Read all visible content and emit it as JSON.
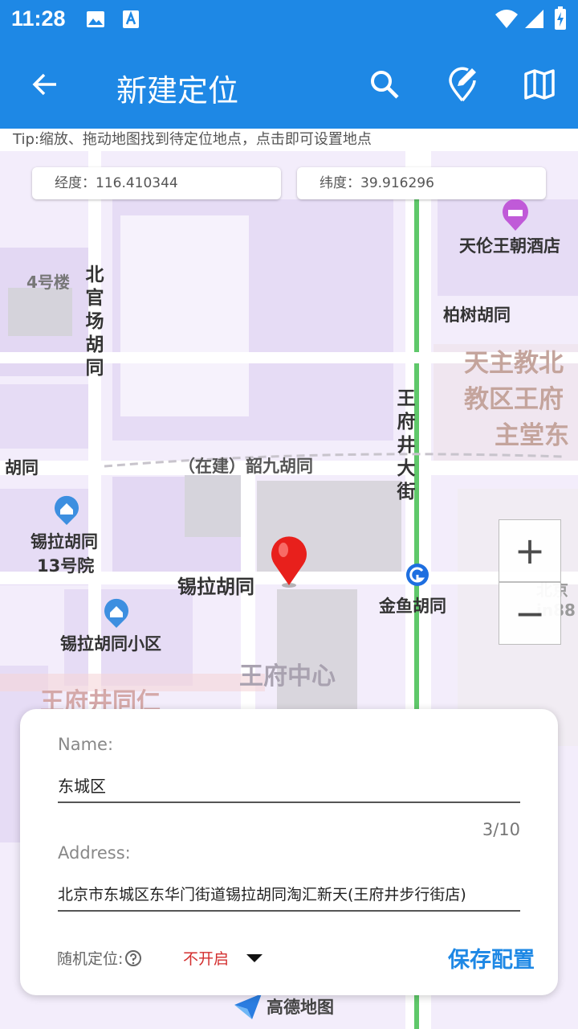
{
  "status_bar": {
    "time": "11:28"
  },
  "app_bar": {
    "title": "新建定位"
  },
  "tip": "Tip:缩放、拖动地图找到待定位地点，点击即可设置地点",
  "coords": {
    "longitude": "经度：116.410344",
    "latitude": "纬度：39.916296"
  },
  "map_labels": {
    "hotel": "天伦王朝酒店",
    "building4": "4号楼",
    "beiguanchang": "北官场胡同",
    "baishu": "柏树胡同",
    "church": [
      "天主教北",
      "教区王府",
      "主堂东"
    ],
    "wangfujing_st": "王府井大街",
    "shaojiu": "（在建）韶九胡同",
    "hutong_left": "胡同",
    "xila13": [
      "锡拉胡同",
      "13号院"
    ],
    "xila": "锡拉胡同",
    "jinyu": "金鱼胡同",
    "xila_xiaoqu": "锡拉胡同小区",
    "wfj_center": "王府中心",
    "wfj_tongren": "王府井同仁",
    "beijing_right": [
      "北京",
      "in88"
    ],
    "logo": "高德地图"
  },
  "zoom": {
    "in": "+",
    "out": "−"
  },
  "form": {
    "name_label": "Name:",
    "name_value": "东城区",
    "counter": "3/10",
    "address_label": "Address:",
    "address_value": "北京市东城区东华门街道锡拉胡同淘汇新天(王府井步行街店)",
    "random_label": "随机定位:",
    "random_value": "不开启",
    "save": "保存配置"
  },
  "colors": {
    "primary": "#1e88e5",
    "accent": "#1e88e5",
    "warn": "#d32f2f"
  },
  "icons": [
    "back-arrow-icon",
    "search-icon",
    "edit-location-icon",
    "map-icon",
    "help-icon",
    "dropdown-arrow-icon",
    "location-pin-icon"
  ]
}
